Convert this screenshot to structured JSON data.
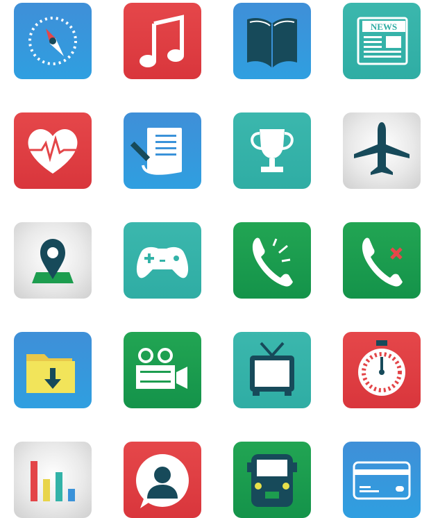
{
  "icons": [
    {
      "name": "compass-icon",
      "row": 1,
      "col": 1,
      "color": "#3a92d9"
    },
    {
      "name": "music-note-icon",
      "row": 1,
      "col": 2,
      "color": "#e34548"
    },
    {
      "name": "open-book-icon",
      "row": 1,
      "col": 3,
      "color": "#3a92d9"
    },
    {
      "name": "newspaper-icon",
      "row": 1,
      "col": 4,
      "color": "#33b3a8",
      "label": "NEWS"
    },
    {
      "name": "heart-rate-icon",
      "row": 2,
      "col": 1,
      "color": "#e34548"
    },
    {
      "name": "notepad-icon",
      "row": 2,
      "col": 2,
      "color": "#3a92d9"
    },
    {
      "name": "trophy-icon",
      "row": 2,
      "col": 3,
      "color": "#33b3a8"
    },
    {
      "name": "airplane-icon",
      "row": 2,
      "col": 4,
      "color": "#dcdcdc"
    },
    {
      "name": "map-pin-icon",
      "row": 3,
      "col": 1,
      "color": "#dcdcdc"
    },
    {
      "name": "gamepad-icon",
      "row": 3,
      "col": 2,
      "color": "#33b3a8"
    },
    {
      "name": "phone-ringing-icon",
      "row": 3,
      "col": 3,
      "color": "#1d9d4f"
    },
    {
      "name": "phone-declined-icon",
      "row": 3,
      "col": 4,
      "color": "#1d9d4f"
    },
    {
      "name": "download-folder-icon",
      "row": 4,
      "col": 1,
      "color": "#3a92d9"
    },
    {
      "name": "video-camera-icon",
      "row": 4,
      "col": 2,
      "color": "#1d9d4f"
    },
    {
      "name": "television-icon",
      "row": 4,
      "col": 3,
      "color": "#33b3a8"
    },
    {
      "name": "stopwatch-icon",
      "row": 4,
      "col": 4,
      "color": "#e34548"
    },
    {
      "name": "bar-chart-icon",
      "row": 5,
      "col": 1,
      "color": "#dcdcdc"
    },
    {
      "name": "contact-chat-icon",
      "row": 5,
      "col": 2,
      "color": "#e34548"
    },
    {
      "name": "bus-icon",
      "row": 5,
      "col": 3,
      "color": "#1d9d4f"
    },
    {
      "name": "credit-card-icon",
      "row": 5,
      "col": 4,
      "color": "#3a92d9"
    }
  ]
}
